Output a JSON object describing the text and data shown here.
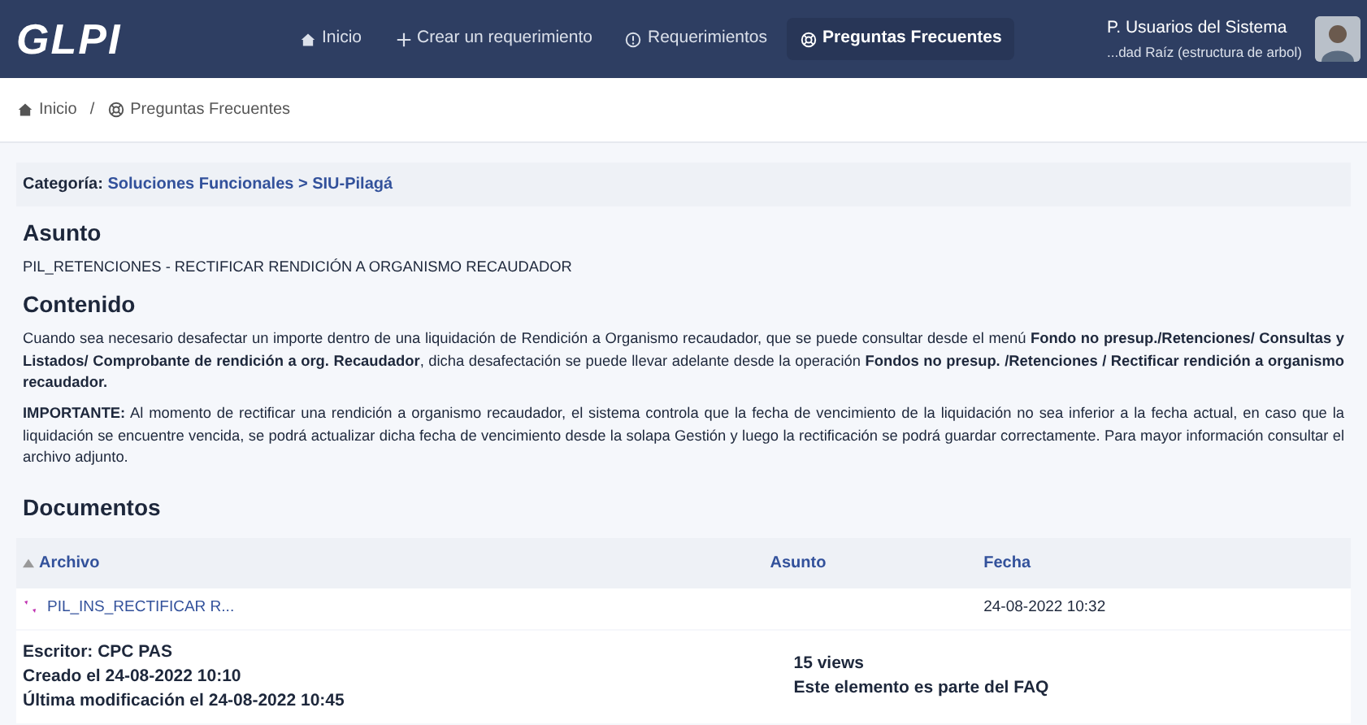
{
  "logo": "GLPI",
  "nav": [
    {
      "kind": "home",
      "label": "Inicio",
      "selected": false
    },
    {
      "kind": "plus",
      "label": "Crear un requerimiento",
      "selected": false
    },
    {
      "kind": "alert",
      "label": "Requerimientos",
      "selected": false
    },
    {
      "kind": "help",
      "label": "Preguntas Frecuentes",
      "selected": true
    }
  ],
  "user": {
    "name": "P. Usuarios del Sistema",
    "entity": "...dad Raíz (estructura de arbol)"
  },
  "breadcrumb": [
    {
      "kind": "home",
      "label": "Inicio"
    },
    {
      "kind": "help",
      "label": "Preguntas Frecuentes"
    }
  ],
  "breadcrumb_separator": "/",
  "category": {
    "label": "Categoría:",
    "value": "Soluciones Funcionales > SIU-Pilagá"
  },
  "subject": {
    "heading": "Asunto",
    "text": "PIL_RETENCIONES - RECTIFICAR RENDICIÓN A ORGANISMO RECAUDADOR"
  },
  "content": {
    "heading": "Contenido",
    "paragraphs": [
      "Cuando sea necesario desafectar un importe dentro de una liquidación de Rendición a Organismo recaudador, que se puede consultar desde el menú **Fondo no presup./Retenciones/ Consultas y Listados/ Comprobante de rendición a org. Recaudador**, dicha desafectación se puede llevar adelante desde la operación **Fondos no presup. /Retenciones / Rectificar rendición a organismo recaudador.**",
      "**IMPORTANTE:** Al momento de rectificar una rendición a organismo recaudador, el sistema controla que la fecha de vencimiento de la liquidación no sea inferior a la fecha actual, en caso que la liquidación se encuentre vencida, se podrá actualizar dicha fecha de vencimiento desde la solapa Gestión y luego la rectificación se podrá guardar correctamente. Para mayor información consultar el archivo adjunto."
    ]
  },
  "documents": {
    "heading": "Documentos",
    "columns": [
      "Archivo",
      "Asunto",
      "Fecha"
    ],
    "rows": [
      {
        "file": "PIL_INS_RECTIFICAR R...",
        "date": "24-08-2022 10:32"
      }
    ]
  },
  "footer": {
    "left": [
      "Escritor: CPC PAS",
      "Creado el 24-08-2022 10:10",
      "Última modificación el 24-08-2022 10:45"
    ],
    "right": [
      "15 views",
      "Este elemento es parte del FAQ"
    ]
  }
}
